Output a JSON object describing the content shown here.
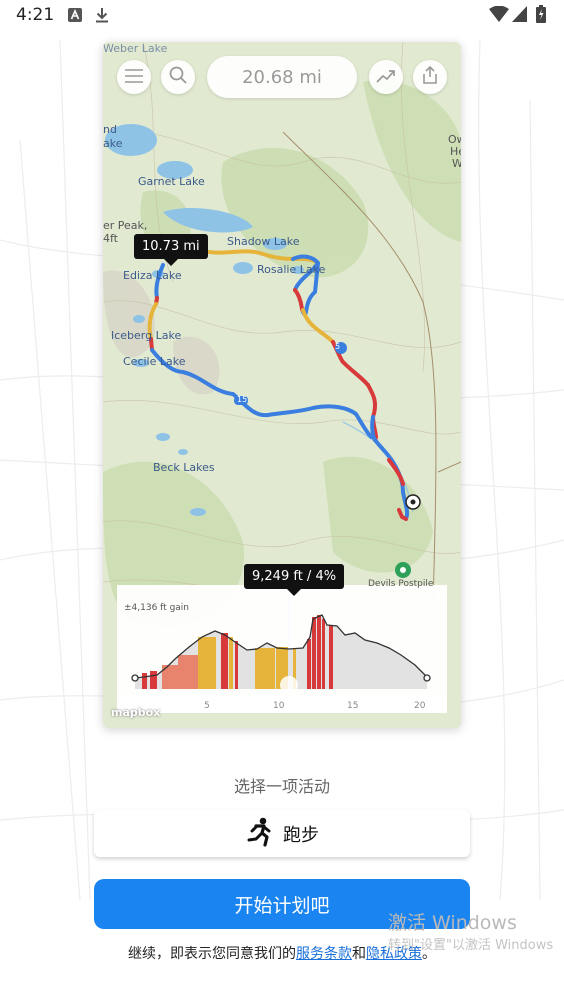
{
  "status_bar": {
    "time": "4:21",
    "icons": [
      "a-notification-icon",
      "download-icon",
      "wifi-icon",
      "signal-icon",
      "battery-icon"
    ]
  },
  "map": {
    "distance": "20.68 mi",
    "labels": {
      "weber_lake": "Weber Lake",
      "garnet_lake": "Garnet Lake",
      "shadow_lake": "Shadow Lake",
      "rosalie_lake": "Rosalie Lake",
      "ediza_lake": "Ediza Lake",
      "iceberg_lake": "Iceberg Lake",
      "cecile_lake": "Cecile Lake",
      "beck_lakes": "Beck Lakes",
      "peak": "er Peak,",
      "peak_elev": "4ft",
      "left_top": "nd",
      "left_top2": "ake",
      "right_1": "Ow",
      "right_2": "He",
      "right_3": "W",
      "devils": "Devils Postpile",
      "route_5": "5",
      "route_15": "15"
    },
    "marker_distance": "10.73 mi",
    "elevation_marker": "9,249 ft / 4%",
    "gain": "±4,136 ft gain",
    "ticks": [
      "5",
      "10",
      "15",
      "20"
    ],
    "attribution": "mapbox"
  },
  "activity": {
    "prompt": "选择一项活动",
    "selected": "跑步"
  },
  "start_button": "开始计划吧",
  "terms": {
    "prefix": "继续，即表示您同意我们的",
    "service_link": "服务条款",
    "and": "和",
    "privacy_link": "隐私政策",
    "suffix": "。"
  },
  "watermark": {
    "line1": "激活 Windows",
    "line2": "转到\"设置\"以激活 Windows"
  },
  "colors": {
    "accent": "#1a84f1",
    "route_blue": "#3a7ee0",
    "route_red": "#d8393a",
    "route_yellow": "#e6b43a"
  }
}
